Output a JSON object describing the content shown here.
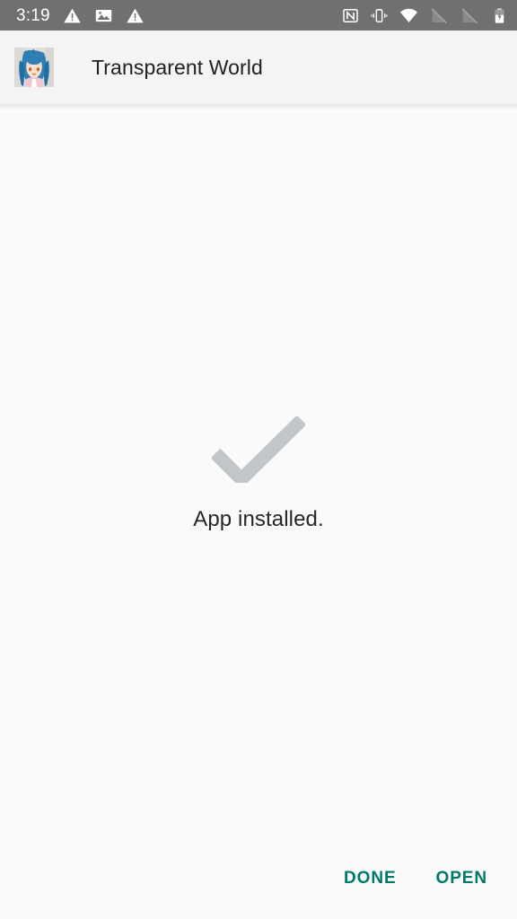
{
  "statusbar": {
    "time": "3:19",
    "left_icons": [
      {
        "name": "warning-triangle-icon",
        "label": "warning"
      },
      {
        "name": "image-icon",
        "label": "screenshot"
      },
      {
        "name": "warning-triangle-icon",
        "label": "warning"
      }
    ],
    "right_icons": [
      {
        "name": "nfc-icon",
        "label": "NFC"
      },
      {
        "name": "vibrate-icon",
        "label": "Vibrate"
      },
      {
        "name": "wifi-icon",
        "label": "Wi-Fi"
      },
      {
        "name": "no-signal-icon",
        "label": "No signal"
      },
      {
        "name": "no-signal-icon",
        "label": "No signal"
      },
      {
        "name": "battery-charging-icon",
        "label": "Battery charging"
      }
    ],
    "background": "#707070",
    "foreground": "#ffffff"
  },
  "appbar": {
    "title": "Transparent World",
    "icon_name": "app-icon",
    "background": "#f4f4f4",
    "title_color": "#212121"
  },
  "main": {
    "status_icon_name": "checkmark-icon",
    "status_icon_color": "#c1c6c9",
    "status_text": "App installed."
  },
  "actions": {
    "accent_color": "#00796b",
    "buttons": [
      {
        "name": "done-button",
        "label": "DONE"
      },
      {
        "name": "open-button",
        "label": "OPEN"
      }
    ]
  }
}
